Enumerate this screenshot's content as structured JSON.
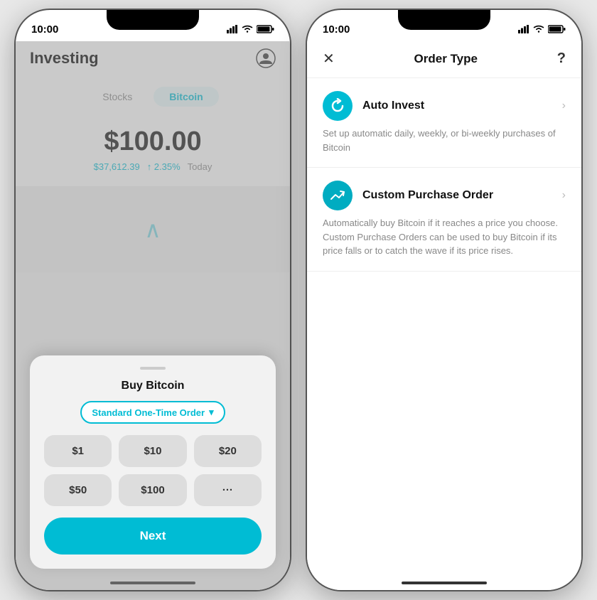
{
  "left_phone": {
    "status_time": "10:00",
    "header_title": "Investing",
    "tabs": [
      {
        "label": "Stocks",
        "active": false
      },
      {
        "label": "Bitcoin",
        "active": true
      }
    ],
    "price": "$100.00",
    "btc_price": "$37,612.39",
    "change": "↑ 2.35%",
    "period": "Today",
    "bottom_sheet": {
      "title": "Buy Bitcoin",
      "order_type": "Standard One-Time Order",
      "order_type_chevron": "▾",
      "amounts": [
        "$1",
        "$10",
        "$20",
        "$50",
        "$100",
        "···"
      ],
      "next_button": "Next"
    }
  },
  "right_phone": {
    "status_time": "10:00",
    "header": {
      "close": "✕",
      "title": "Order Type",
      "help": "?"
    },
    "options": [
      {
        "icon": "↻",
        "name": "Auto Invest",
        "description": "Set up automatic daily, weekly, or bi-weekly purchases of Bitcoin"
      },
      {
        "icon": "⤴",
        "name": "Custom Purchase Order",
        "description": "Automatically buy Bitcoin if it reaches a price you choose. Custom Purchase Orders can be used to buy Bitcoin if its price falls or to catch the wave if its price rises."
      }
    ]
  }
}
